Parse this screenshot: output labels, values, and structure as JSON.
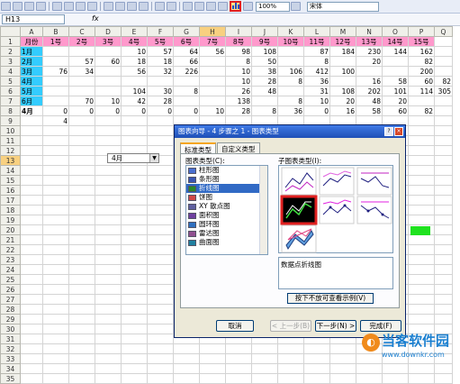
{
  "toolbar": {
    "zoom": "100%",
    "font": "宋体"
  },
  "formula_bar": {
    "cell_ref": "H13",
    "fx": "fx"
  },
  "columns": [
    "A",
    "B",
    "C",
    "D",
    "E",
    "F",
    "G",
    "H",
    "I",
    "J",
    "K",
    "L",
    "M",
    "N",
    "O",
    "P",
    "Q"
  ],
  "rows": [
    {
      "n": "1",
      "cells": [
        "月份",
        "1号",
        "2号",
        "3号",
        "4号",
        "5号",
        "6号",
        "7号",
        "8号",
        "9号",
        "10号",
        "11号",
        "12号",
        "13号",
        "14号",
        "15号",
        ""
      ]
    },
    {
      "n": "2",
      "cells": [
        "1月",
        "",
        "",
        "",
        "10",
        "57",
        "64",
        "56",
        "98",
        "108",
        "",
        "87",
        "184",
        "230",
        "144",
        "162",
        ""
      ]
    },
    {
      "n": "3",
      "cells": [
        "2月",
        "",
        "57",
        "60",
        "18",
        "18",
        "66",
        "",
        "8",
        "50",
        "",
        "8",
        "",
        "20",
        "",
        "82",
        ""
      ]
    },
    {
      "n": "4",
      "cells": [
        "3月",
        "76",
        "34",
        "",
        "56",
        "32",
        "226",
        "",
        "10",
        "38",
        "106",
        "412",
        "100",
        "",
        "",
        "200",
        ""
      ]
    },
    {
      "n": "5",
      "cells": [
        "4月",
        "",
        "",
        "",
        "",
        "",
        "",
        "",
        "10",
        "28",
        "8",
        "36",
        "",
        "16",
        "58",
        "60",
        "82"
      ]
    },
    {
      "n": "6",
      "cells": [
        "5月",
        "",
        "",
        "",
        "104",
        "30",
        "8",
        "",
        "26",
        "48",
        "",
        "31",
        "108",
        "202",
        "101",
        "114",
        "305"
      ]
    },
    {
      "n": "7",
      "cells": [
        "6月",
        "",
        "70",
        "10",
        "42",
        "28",
        "",
        "",
        "138",
        "",
        "8",
        "10",
        "20",
        "48",
        "20",
        "",
        ""
      ]
    },
    {
      "n": "8",
      "cells": [
        "4月",
        "0",
        "0",
        "0",
        "0",
        "0",
        "0",
        "10",
        "28",
        "8",
        "36",
        "0",
        "16",
        "58",
        "60",
        "82",
        ""
      ]
    },
    {
      "n": "9",
      "cells": [
        "",
        "4",
        "",
        "",
        "",
        "",
        "",
        "",
        "",
        "",
        "",
        "",
        "",
        "",
        "",
        "",
        ""
      ]
    },
    {
      "n": "10",
      "cells": []
    },
    {
      "n": "11",
      "cells": []
    },
    {
      "n": "12",
      "cells": []
    },
    {
      "n": "13",
      "cells": []
    },
    {
      "n": "14",
      "cells": []
    },
    {
      "n": "15",
      "cells": []
    },
    {
      "n": "16",
      "cells": []
    },
    {
      "n": "17",
      "cells": []
    },
    {
      "n": "18",
      "cells": []
    },
    {
      "n": "19",
      "cells": []
    },
    {
      "n": "20",
      "cells": []
    },
    {
      "n": "21",
      "cells": []
    },
    {
      "n": "22",
      "cells": []
    },
    {
      "n": "23",
      "cells": []
    },
    {
      "n": "24",
      "cells": []
    },
    {
      "n": "25",
      "cells": []
    },
    {
      "n": "26",
      "cells": []
    },
    {
      "n": "27",
      "cells": []
    },
    {
      "n": "28",
      "cells": []
    },
    {
      "n": "29",
      "cells": []
    },
    {
      "n": "30",
      "cells": []
    },
    {
      "n": "31",
      "cells": []
    },
    {
      "n": "32",
      "cells": []
    },
    {
      "n": "33",
      "cells": []
    },
    {
      "n": "34",
      "cells": []
    },
    {
      "n": "35",
      "cells": []
    }
  ],
  "combo": {
    "value": "4月"
  },
  "dialog": {
    "title": "图表向导 - 4 步骤之 1 - 图表类型",
    "tabs": [
      "标准类型",
      "自定义类型"
    ],
    "type_label": "图表类型(C):",
    "subtype_label": "子图表类型(I):",
    "types": [
      {
        "label": "柱形图",
        "color": "#4a6fd0"
      },
      {
        "label": "条形图",
        "color": "#3a55b0"
      },
      {
        "label": "折线图",
        "color": "#2a8a2a"
      },
      {
        "label": "饼图",
        "color": "#d04848"
      },
      {
        "label": "XY 散点图",
        "color": "#6060a0"
      },
      {
        "label": "面积图",
        "color": "#7040a0"
      },
      {
        "label": "圆环图",
        "color": "#3070c0"
      },
      {
        "label": "雷达图",
        "color": "#905090"
      },
      {
        "label": "曲面图",
        "color": "#2080a0"
      }
    ],
    "selected_type": "折线图",
    "description": "数据点折线图",
    "preview_button": "按下不放可查看示例(V)",
    "buttons": {
      "cancel": "取消",
      "back": "< 上一步(B)",
      "next": "下一步(N) >",
      "finish": "完成(F)"
    }
  },
  "watermark": {
    "name": "当客软件园",
    "url": "www.downkr.com"
  }
}
